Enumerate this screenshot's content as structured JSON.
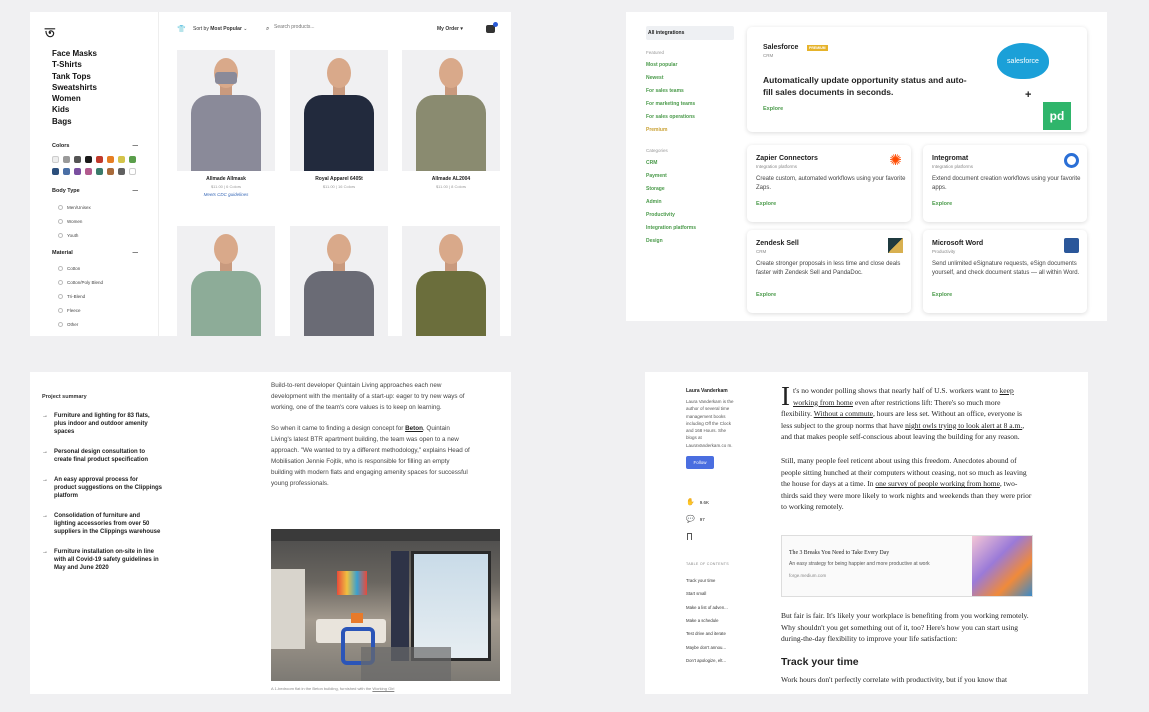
{
  "shop": {
    "logo": "ত",
    "categories": [
      "Face Masks",
      "T-Shirts",
      "Tank Tops",
      "Sweatshirts",
      "Women",
      "Kids",
      "Bags"
    ],
    "colors_label": "Colors",
    "colors": [
      "#eeeeee",
      "#9a9a9a",
      "#555555",
      "#1a1a1a",
      "#c0392b",
      "#e67e22",
      "#d4c44a",
      "#5a9e4b",
      "#2c4f7c",
      "#4a6fa5",
      "#7a4fa0",
      "#b25a8e",
      "#3a7a6a",
      "#a86a3a",
      "#606060",
      "#ffffff"
    ],
    "body_type_label": "Body Type",
    "body_types": [
      "Men/Unisex",
      "Women",
      "Youth"
    ],
    "material_label": "Material",
    "materials": [
      "Cotton",
      "Cotton/Poly Blend",
      "Tri-Blend",
      "Fleece",
      "Other"
    ],
    "sort_label": "Sort by",
    "sort_value": "Most Popular",
    "search_placeholder": "Search products...",
    "my_order": "My Order",
    "products": [
      {
        "name": "Allmade Allmask",
        "meta": "$11.00 | 6 Colors",
        "link": "Meets CDC guidelines",
        "color": "#8a8a99",
        "mask": true
      },
      {
        "name": "Royal Apparel 6405t",
        "meta": "$11.00 | 16 Colors",
        "link": "",
        "color": "#222a3d"
      },
      {
        "name": "Allmade AL2004",
        "meta": "$11.00 | 8 Colors",
        "link": "",
        "color": "#8a8b70"
      },
      {
        "name": "",
        "meta": "",
        "link": "",
        "color": "#8dac98"
      },
      {
        "name": "",
        "meta": "",
        "link": "",
        "color": "#6a6b75"
      },
      {
        "name": "",
        "meta": "",
        "link": "",
        "color": "#6b6e3c"
      }
    ]
  },
  "integrations": {
    "all_label": "All integrations",
    "featured_label": "Featured",
    "featured": [
      "Most popular",
      "Newest",
      "For sales teams",
      "For marketing teams",
      "For sales operations",
      "Premium"
    ],
    "categories_label": "Categories",
    "categories": [
      "CRM",
      "Payment",
      "Storage",
      "Admin",
      "Productivity",
      "Integration platforms",
      "Design"
    ],
    "hero": {
      "title": "Salesforce",
      "badge": "PREMIUM",
      "sub": "CRM",
      "headline": "Automatically update opportunity status and auto-fill sales documents in seconds.",
      "explore": "Explore",
      "logo_text": "salesforce",
      "plus": "+"
    },
    "cards": [
      {
        "title": "Zapier Connectors",
        "sub": "Integration platforms",
        "desc": "Create custom, automated workflows using your favorite Zaps.",
        "explore": "Explore",
        "icon": "zapier-icon",
        "color": "#ff4a00"
      },
      {
        "title": "Integromat",
        "sub": "Integration platforms",
        "desc": "Extend document creation workflows using your favorite apps.",
        "explore": "Explore",
        "icon": "power-icon",
        "color": "#2a6fd6"
      },
      {
        "title": "Zendesk Sell",
        "sub": "CRM",
        "desc": "Create stronger proposals in less time and close deals faster with Zendesk Sell and PandaDoc.",
        "explore": "Explore",
        "icon": "zendesk-icon",
        "color": "#d8b050"
      },
      {
        "title": "Microsoft Word",
        "sub": "Productivity",
        "desc": "Send unlimited eSignature requests, eSign documents yourself, and check document status — all within Word.",
        "explore": "Explore",
        "icon": "word-icon",
        "color": "#2b579a"
      }
    ]
  },
  "project": {
    "summary_label": "Project summary",
    "items": [
      "Furniture and lighting for 83 flats, plus indoor and outdoor amenity spaces",
      "Personal design consultation to create final product specification",
      "An easy approval process for product suggestions on the Clippings platform",
      "Consolidation of furniture and lighting accessories from over 50 suppliers in the Clippings warehouse",
      "Furniture installation on-site in line with all Covid-19 safety guidelines in May and June 2020"
    ],
    "para1": "Build-to-rent developer Quintain Living approaches each new development with the mentality of a start-up: eager to try new ways of working, one of the team's core values is to keep on learning.",
    "para2_a": "So when it came to finding a design concept for ",
    "para2_link": "Beton",
    "para2_b": ", Quintain Living's latest BTR apartment building, the team was open to a new approach. \"We wanted to try a different methodology,\" explains Head of Mobilisation Jennie Fojtik, who is responsible for filling an empty building with modern flats and engaging amenity spaces for successful young professionals.",
    "caption_a": "A 1-bedroom flat in the Beton building, furnished with the ",
    "caption_link": "Working Girl"
  },
  "article": {
    "author": "Laura Vanderkam",
    "bio": "Laura Vanderkam is the author of several time management books including Off the Clock and 168 Hours. She blogs at LauraVanderkam.co m.",
    "follow": "Follow",
    "claps": "9.6K",
    "responses": "97",
    "toc_label": "TABLE OF CONTENTS",
    "toc": [
      "Track your time",
      "Start small",
      "Make a list of adven...",
      "Make a schedule",
      "Test drive and iterate",
      "Maybe don't annou...",
      "Don't apologize, elt..."
    ],
    "dropcap": "I",
    "p1_a": "t's no wonder polling shows that nearly half of U.S. workers want to ",
    "p1_l1": "keep working from home",
    "p1_b": " even after restrictions lift: There's so much more flexibility. ",
    "p1_l2": "Without a commute",
    "p1_c": ", hours are less set. Without an office, everyone is less subject to the group norms that have ",
    "p1_l3": "night owls trying to look alert at 8 a.m.",
    "p1_d": ", and that makes people self-conscious about leaving the building for any reason.",
    "p2_a": "Still, many people feel reticent about using this freedom. Anecdotes abound of people sitting hunched at their computers without ceasing, not so much as leaving the house for days at a time. In ",
    "p2_l": "one survey of people working from home",
    "p2_b": ", two-thirds said they were more likely to work nights and weekends than they were prior to working remotely.",
    "embed_title": "The 3 Breaks You Need to Take Every Day",
    "embed_desc": "An easy strategy for being happier and more productive at work",
    "embed_url": "forge.medium.com",
    "p3": "But fair is fair. It's likely your workplace is benefiting from you working remotely. Why shouldn't you get something out of it, too? Here's how you can start using during-the-day flexibility to improve your life satisfaction:",
    "h2": "Track your time",
    "p4": "Work hours don't perfectly correlate with productivity, but if you know that"
  }
}
